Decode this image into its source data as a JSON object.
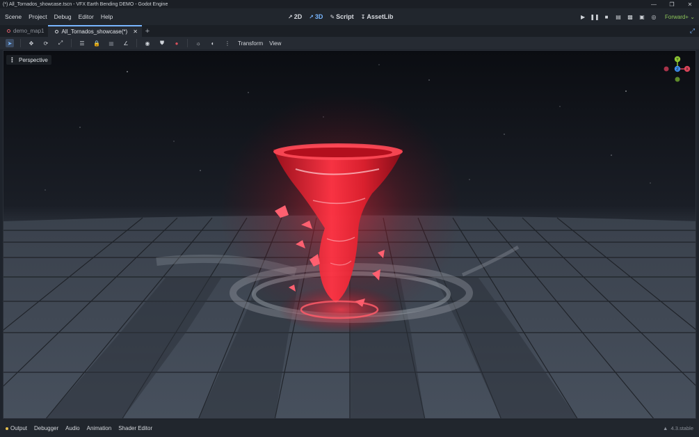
{
  "window": {
    "title": "(*) All_Tornados_showcase.tscn - VFX Earth Bending DEMO - Godot Engine",
    "controls": [
      "minimize-icon",
      "restore-icon",
      "close-icon"
    ]
  },
  "menubar": {
    "items": [
      "Scene",
      "Project",
      "Debug",
      "Editor",
      "Help"
    ]
  },
  "main_screens": [
    {
      "label": "2D",
      "icon": "2d-icon"
    },
    {
      "label": "3D",
      "icon": "3d-icon"
    },
    {
      "label": "Script",
      "icon": "script-icon"
    },
    {
      "label": "AssetLib",
      "icon": "assetlib-icon"
    }
  ],
  "run_bar": {
    "buttons": [
      "play-icon",
      "pause-icon",
      "stop-icon",
      "remote-debug-icon",
      "play-scene-icon",
      "play-custom-icon",
      "movie-maker-icon"
    ],
    "renderer": "Forward+"
  },
  "scene_tabs": [
    {
      "label": "demo_map1",
      "active": false
    },
    {
      "label": "All_Tornados_showcase(*)",
      "active": true
    }
  ],
  "toolbar": {
    "tools": [
      "select-icon",
      "move-icon",
      "rotate-icon",
      "scale-icon",
      "list-icon",
      "lock-icon",
      "group-icon",
      "ruler-icon",
      "local-space-icon",
      "snap-icon",
      "camera-preview-icon",
      "sun-icon",
      "environment-icon",
      "more-icon"
    ],
    "transform_menu": "Transform",
    "view_menu": "View"
  },
  "viewport": {
    "perspective_label": "Perspective",
    "gizmo": {
      "x": "X",
      "y": "Y",
      "z": "Z"
    },
    "colors": {
      "x": "#e0465b",
      "y": "#8dc532",
      "z": "#3e8ff0",
      "tornado": "#ff2a3a"
    }
  },
  "bottom_panel": {
    "tabs": [
      "Output",
      "Debugger",
      "Audio",
      "Animation",
      "Shader Editor"
    ],
    "version": "4.3.stable"
  }
}
